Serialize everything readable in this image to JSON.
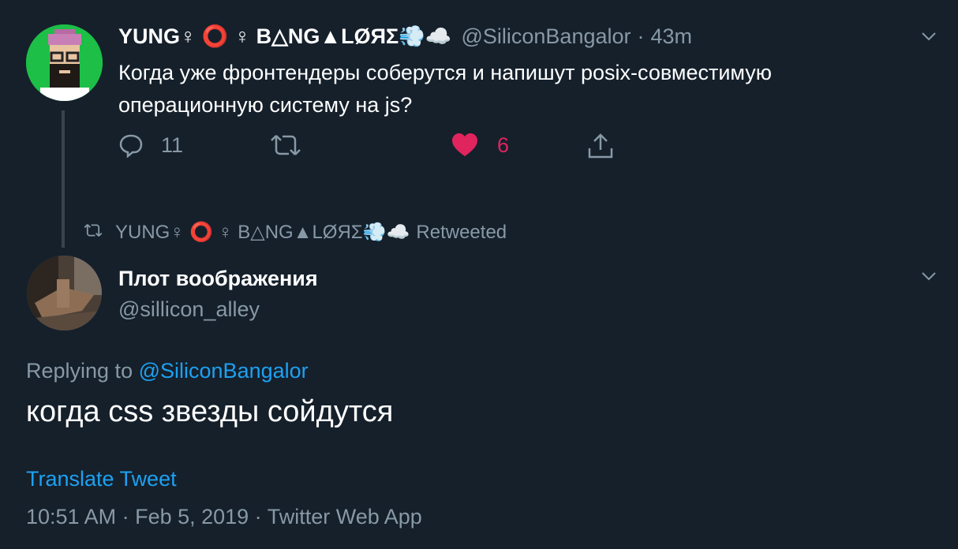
{
  "tweet1": {
    "display_name": "YUNG♀ ⭕ ♀ B△NG▲LØЯΣ💨☁️",
    "handle": "@SiliconBangalor",
    "separator": "·",
    "time": "43m",
    "text": "Когда уже фронтендеры соберутся и напишут posix-совместимую операционную систему на js?",
    "reply_count": "11",
    "like_count": "6"
  },
  "retweet_banner": {
    "name": "YUNG♀ ⭕ ♀ B△NG▲LØЯΣ💨☁️",
    "label": "Retweeted"
  },
  "tweet2": {
    "display_name": "Плот воображения",
    "handle": "@sillicon_alley",
    "replying_prefix": "Replying to",
    "replying_handle": "@SiliconBangalor",
    "text": "когда css звезды сойдутся",
    "translate_label": "Translate Tweet",
    "meta": "10:51 AM · Feb 5, 2019 · Twitter Web App"
  },
  "colors": {
    "background": "#15202b",
    "text_secondary": "#8899a6",
    "link": "#1da1f2",
    "like": "#e0245e",
    "thread_line": "#38444d"
  },
  "icons": [
    "reply-icon",
    "retweet-icon",
    "heart-icon",
    "share-icon",
    "chevron-down-icon"
  ]
}
